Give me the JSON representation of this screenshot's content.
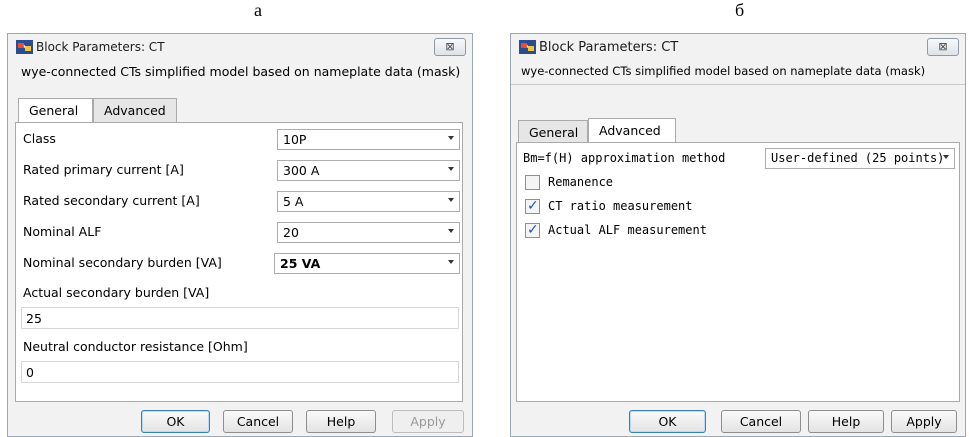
{
  "captions": {
    "left": "а",
    "right": "б"
  },
  "dialog_a": {
    "title": "Block Parameters: CT",
    "close_icon": "⊠",
    "description": "wye-connected CTs simplified model based on nameplate data (mask)",
    "tabs": [
      "General",
      "Advanced"
    ],
    "fields": {
      "class_label": "Class",
      "class_value": "10P",
      "primary_label": "Rated primary current [A]",
      "primary_value": "300 A",
      "secondary_label": "Rated secondary current [A]",
      "secondary_value": "5 A",
      "alf_label": "Nominal ALF",
      "alf_value": "20",
      "burden_label": "Nominal secondary burden [VA]",
      "burden_value": "25 VA",
      "actual_burden_label": "Actual secondary burden [VA]",
      "actual_burden_value": "25",
      "neutral_label": "Neutral conductor resistance [Ohm]",
      "neutral_value": "0"
    },
    "buttons": {
      "ok": "OK",
      "cancel": "Cancel",
      "help": "Help",
      "apply": "Apply"
    }
  },
  "dialog_b": {
    "title": "Block Parameters: CT",
    "close_icon": "⊠",
    "description": "wye-connected CTs simplified model based on nameplate data (mask)",
    "tabs": [
      "General",
      "Advanced"
    ],
    "fields": {
      "method_label": "Bm=f(H) approximation method",
      "method_value": "User-defined (25 points)",
      "remanence_label": "Remanence",
      "remanence_checked": false,
      "ratio_label": "CT ratio measurement",
      "ratio_checked": true,
      "alf_meas_label": "Actual ALF measurement",
      "alf_meas_checked": true
    },
    "buttons": {
      "ok": "OK",
      "cancel": "Cancel",
      "help": "Help",
      "apply": "Apply"
    }
  },
  "colors": {
    "accent": "#3c7fb1",
    "check": "#1d4fb8"
  },
  "icons": {
    "app": "simulink-block-icon",
    "close": "close-icon",
    "dropdown": "chevron-down-icon",
    "check": "checkmark-icon"
  }
}
